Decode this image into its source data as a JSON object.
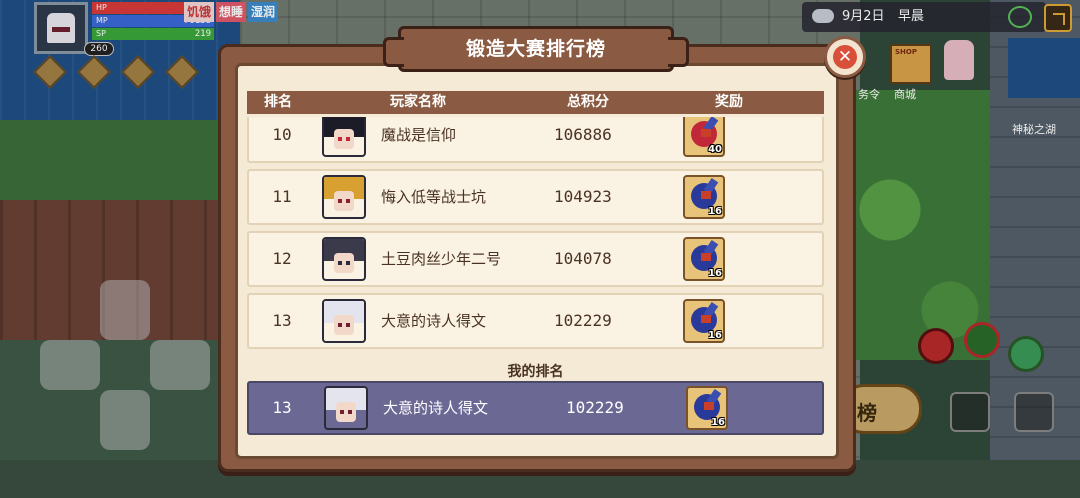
{
  "hud": {
    "level": "260",
    "hp": {
      "label": "HP",
      "value": "40322",
      "fill": 1.0,
      "color": "#d83a3a"
    },
    "mp": {
      "label": "MP",
      "value": "76138",
      "fill": 1.0,
      "color": "#3a6ad8"
    },
    "sp": {
      "label": "SP",
      "value": "219",
      "fill": 1.0,
      "color": "#3aa83a"
    },
    "status": [
      "饥饿",
      "想睡",
      "湿润"
    ],
    "date": "9月2日",
    "period": "早晨"
  },
  "world": {
    "shop_label": "商城",
    "task_label": "务令",
    "map_label": "神秘之湖",
    "rank_button": "榜"
  },
  "leaderboard": {
    "title": "锻造大赛排行榜",
    "close": "✕",
    "headers": {
      "rank": "排名",
      "name": "玩家名称",
      "score": "总积分",
      "reward": "奖励"
    },
    "rows": [
      {
        "rank": "10",
        "name": "魔战是信仰",
        "score": "106886",
        "reward_qty": "40",
        "reward_color": "#c0283a",
        "hair": "#1c1c28",
        "eye": "#c0283a"
      },
      {
        "rank": "11",
        "name": "悔入低等战士坑",
        "score": "104923",
        "reward_qty": "16",
        "reward_color": "#2a3a9a",
        "hair": "#d8a030",
        "eye": "#8a2030"
      },
      {
        "rank": "12",
        "name": "土豆肉丝少年二号",
        "score": "104078",
        "reward_qty": "16",
        "reward_color": "#2a3a9a",
        "hair": "#3a3a4a",
        "eye": "#2a2a3a"
      },
      {
        "rank": "13",
        "name": "大意的诗人得文",
        "score": "102229",
        "reward_qty": "16",
        "reward_color": "#2a3a9a",
        "hair": "#e4e4ee",
        "eye": "#6e2030"
      }
    ],
    "my_rank_label": "我的排名",
    "my_row": {
      "rank": "13",
      "name": "大意的诗人得文",
      "score": "102229",
      "reward_qty": "16",
      "reward_color": "#2a3a9a",
      "hair": "#e4e4ee",
      "eye": "#6e2030"
    }
  }
}
